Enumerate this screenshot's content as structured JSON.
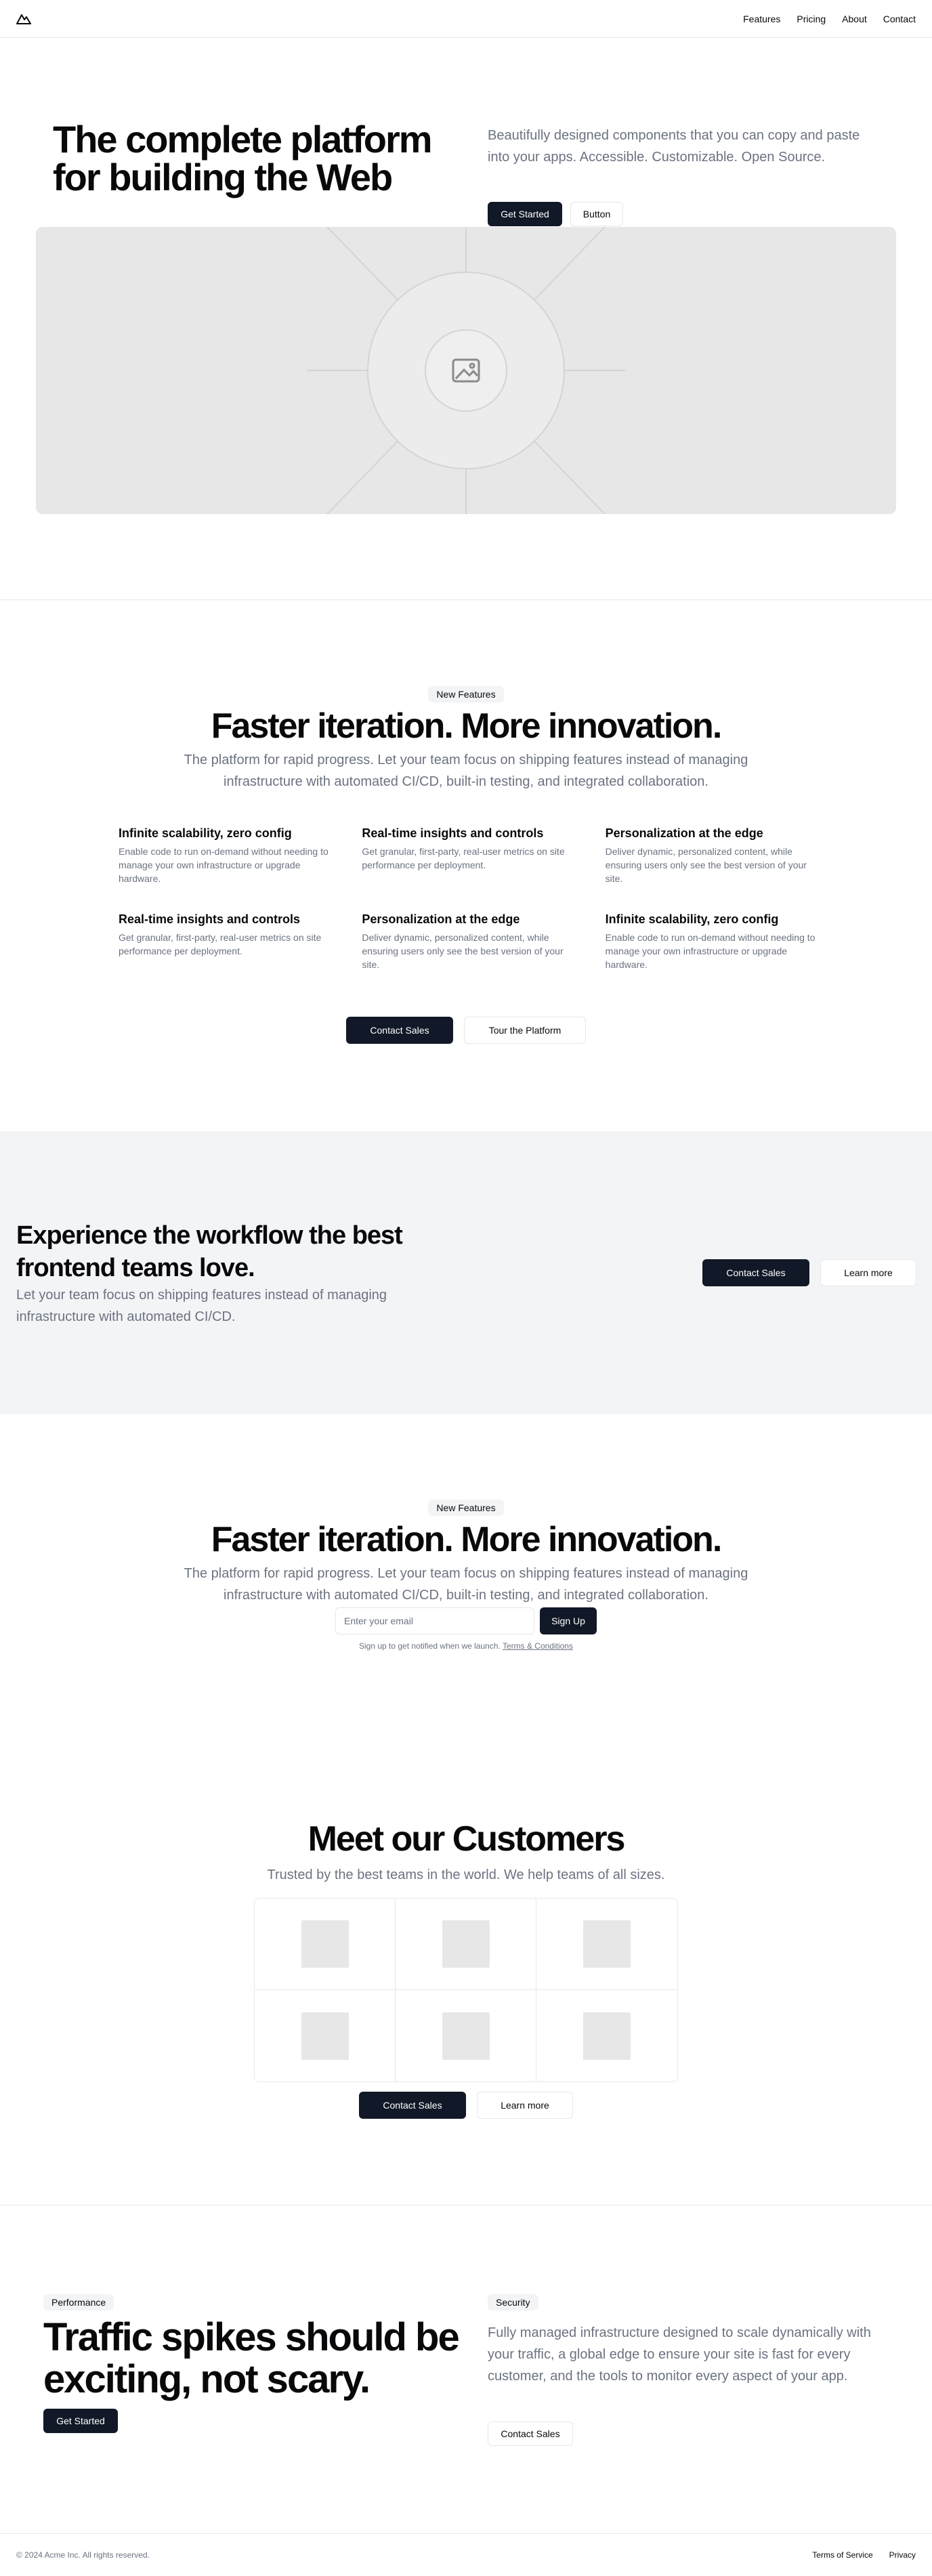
{
  "nav": {
    "items": [
      "Features",
      "Pricing",
      "About",
      "Contact"
    ]
  },
  "hero": {
    "title": "The complete platform for building the Web",
    "description": "Beautifully designed components that you can copy and paste into your apps. Accessible. Customizable. Open Source.",
    "primary_button": "Get Started",
    "secondary_button": "Button"
  },
  "features": {
    "badge": "New Features",
    "title": "Faster iteration. More innovation.",
    "description": "The platform for rapid progress. Let your team focus on shipping features instead of managing infrastructure with automated CI/CD, built-in testing, and integrated collaboration.",
    "items": [
      {
        "title": "Infinite scalability, zero config",
        "text": "Enable code to run on-demand without needing to manage your own infrastructure or upgrade hardware."
      },
      {
        "title": "Real-time insights and controls",
        "text": "Get granular, first-party, real-user metrics on site performance per deployment."
      },
      {
        "title": "Personalization at the edge",
        "text": "Deliver dynamic, personalized content, while ensuring users only see the best version of your site."
      },
      {
        "title": "Real-time insights and controls",
        "text": "Get granular, first-party, real-user metrics on site performance per deployment."
      },
      {
        "title": "Personalization at the edge",
        "text": "Deliver dynamic, personalized content, while ensuring users only see the best version of your site."
      },
      {
        "title": "Infinite scalability, zero config",
        "text": "Enable code to run on-demand without needing to manage your own infrastructure or upgrade hardware."
      }
    ],
    "primary_button": "Contact Sales",
    "secondary_button": "Tour the Platform"
  },
  "cta": {
    "title": "Experience the workflow the best frontend teams love.",
    "description": "Let your team focus on shipping features instead of managing infrastructure with automated CI/CD.",
    "primary_button": "Contact Sales",
    "secondary_button": "Learn more"
  },
  "signup": {
    "badge": "New Features",
    "title": "Faster iteration. More innovation.",
    "description": "The platform for rapid progress. Let your team focus on shipping features instead of managing infrastructure with automated CI/CD, built-in testing, and integrated collaboration.",
    "email_placeholder": "Enter your email",
    "button": "Sign Up",
    "note": "Sign up to get notified when we launch.",
    "terms_link": "Terms & Conditions"
  },
  "customers": {
    "title": "Meet our Customers",
    "description": "Trusted by the best teams in the world. We help teams of all sizes.",
    "primary_button": "Contact Sales",
    "secondary_button": "Learn more"
  },
  "performance": {
    "badge": "Performance",
    "title": "Traffic spikes should be exciting, not scary.",
    "button": "Get Started"
  },
  "security": {
    "badge": "Security",
    "description": "Fully managed infrastructure designed to scale dynamically with your traffic, a global edge to ensure your site is fast for every customer, and the tools to monitor every aspect of your app.",
    "button": "Contact Sales"
  },
  "footer": {
    "copyright": "© 2024 Acme Inc. All rights reserved.",
    "links": [
      "Terms of Service",
      "Privacy"
    ]
  }
}
